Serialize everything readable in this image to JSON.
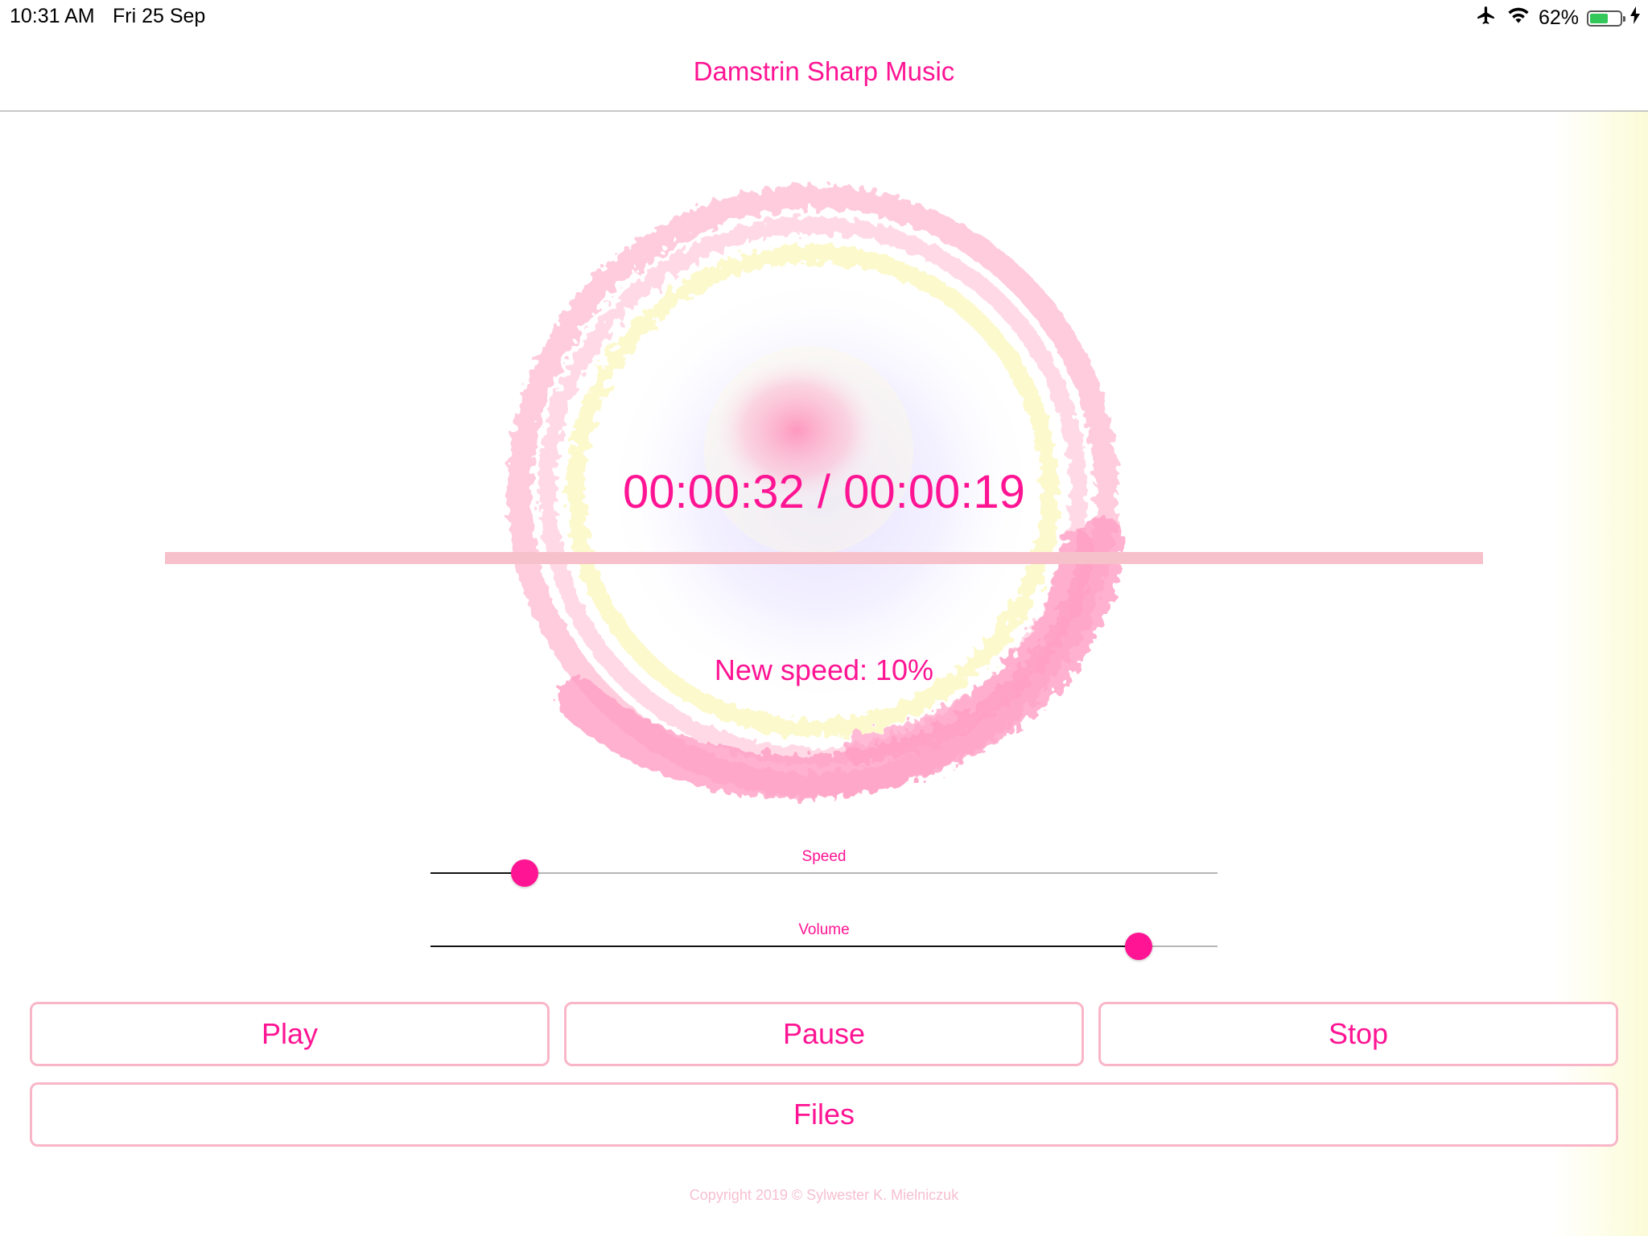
{
  "status_bar": {
    "time": "10:31 AM",
    "date": "Fri 25 Sep",
    "battery_text": "62%",
    "battery_level": 0.62,
    "icons": [
      "airplane-icon",
      "wifi-icon",
      "battery-icon",
      "charging-bolt-icon"
    ]
  },
  "app": {
    "title": "Damstrin Sharp Music"
  },
  "player": {
    "time_text": "00:00:32 / 00:00:19",
    "progress_fraction": 1.0,
    "speed_text": "New speed: 10%"
  },
  "sliders": {
    "speed": {
      "label": "Speed",
      "value": 0.12
    },
    "volume": {
      "label": "Volume",
      "value": 0.9
    }
  },
  "buttons": {
    "play": "Play",
    "pause": "Pause",
    "stop": "Stop",
    "files": "Files"
  },
  "footer": {
    "copyright": "Copyright 2019 © Sylwester K. Mielniczuk"
  },
  "colors": {
    "accent": "#ff1493",
    "button_border": "#f9b6c8",
    "progress": "#f7c1cc"
  }
}
